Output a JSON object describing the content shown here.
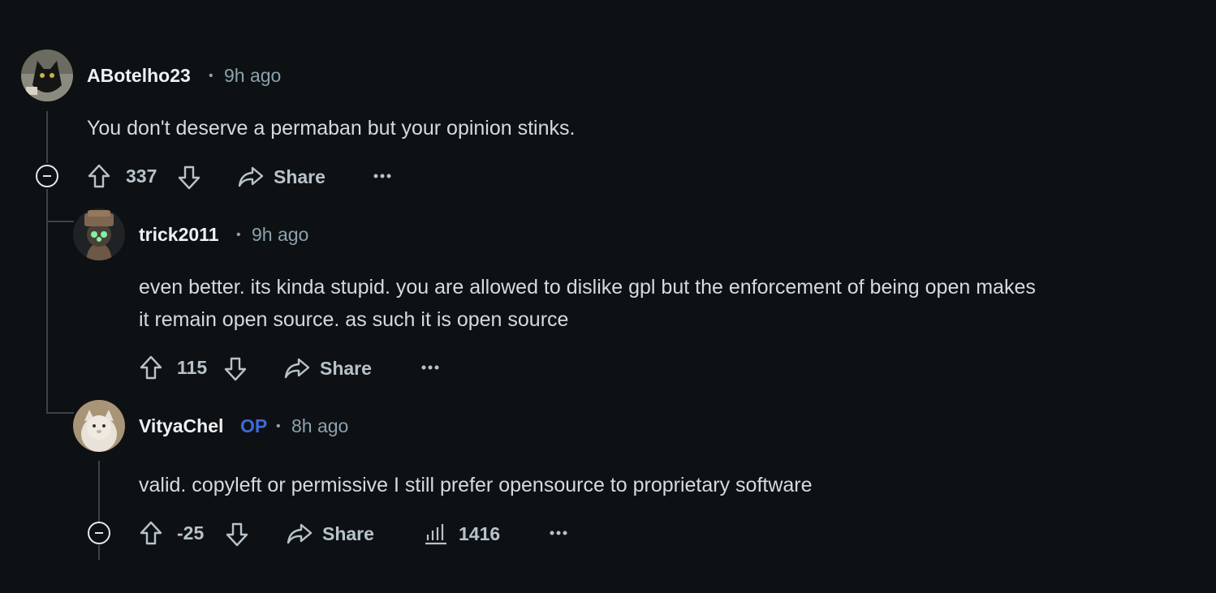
{
  "comments": [
    {
      "username": "ABotelho23",
      "time": "9h ago",
      "text": "You don't deserve a permaban but your opinion stinks.",
      "score": "337",
      "share_label": "Share"
    },
    {
      "username": "trick2011",
      "time": "9h ago",
      "text_line1": "even better. its kinda stupid. you are allowed to dislike gpl but the enforcement of being open makes",
      "text_line2": "it remain open source. as such it is open source",
      "score": "115",
      "share_label": "Share"
    },
    {
      "username": "VityaChel",
      "op_badge": "OP",
      "time": "8h ago",
      "text": "valid. copyleft or permissive I still prefer opensource to proprietary software",
      "score": "-25",
      "share_label": "Share",
      "views": "1416"
    }
  ],
  "colors": {
    "background": "#0e1113",
    "text": "#d7dadc",
    "meta": "#8ba2ad",
    "op_badge": "#3d6ad6",
    "thread_line": "#3a4349"
  },
  "icons": [
    "upvote-icon",
    "downvote-icon",
    "share-icon",
    "more-icon",
    "collapse-icon",
    "views-icon"
  ]
}
